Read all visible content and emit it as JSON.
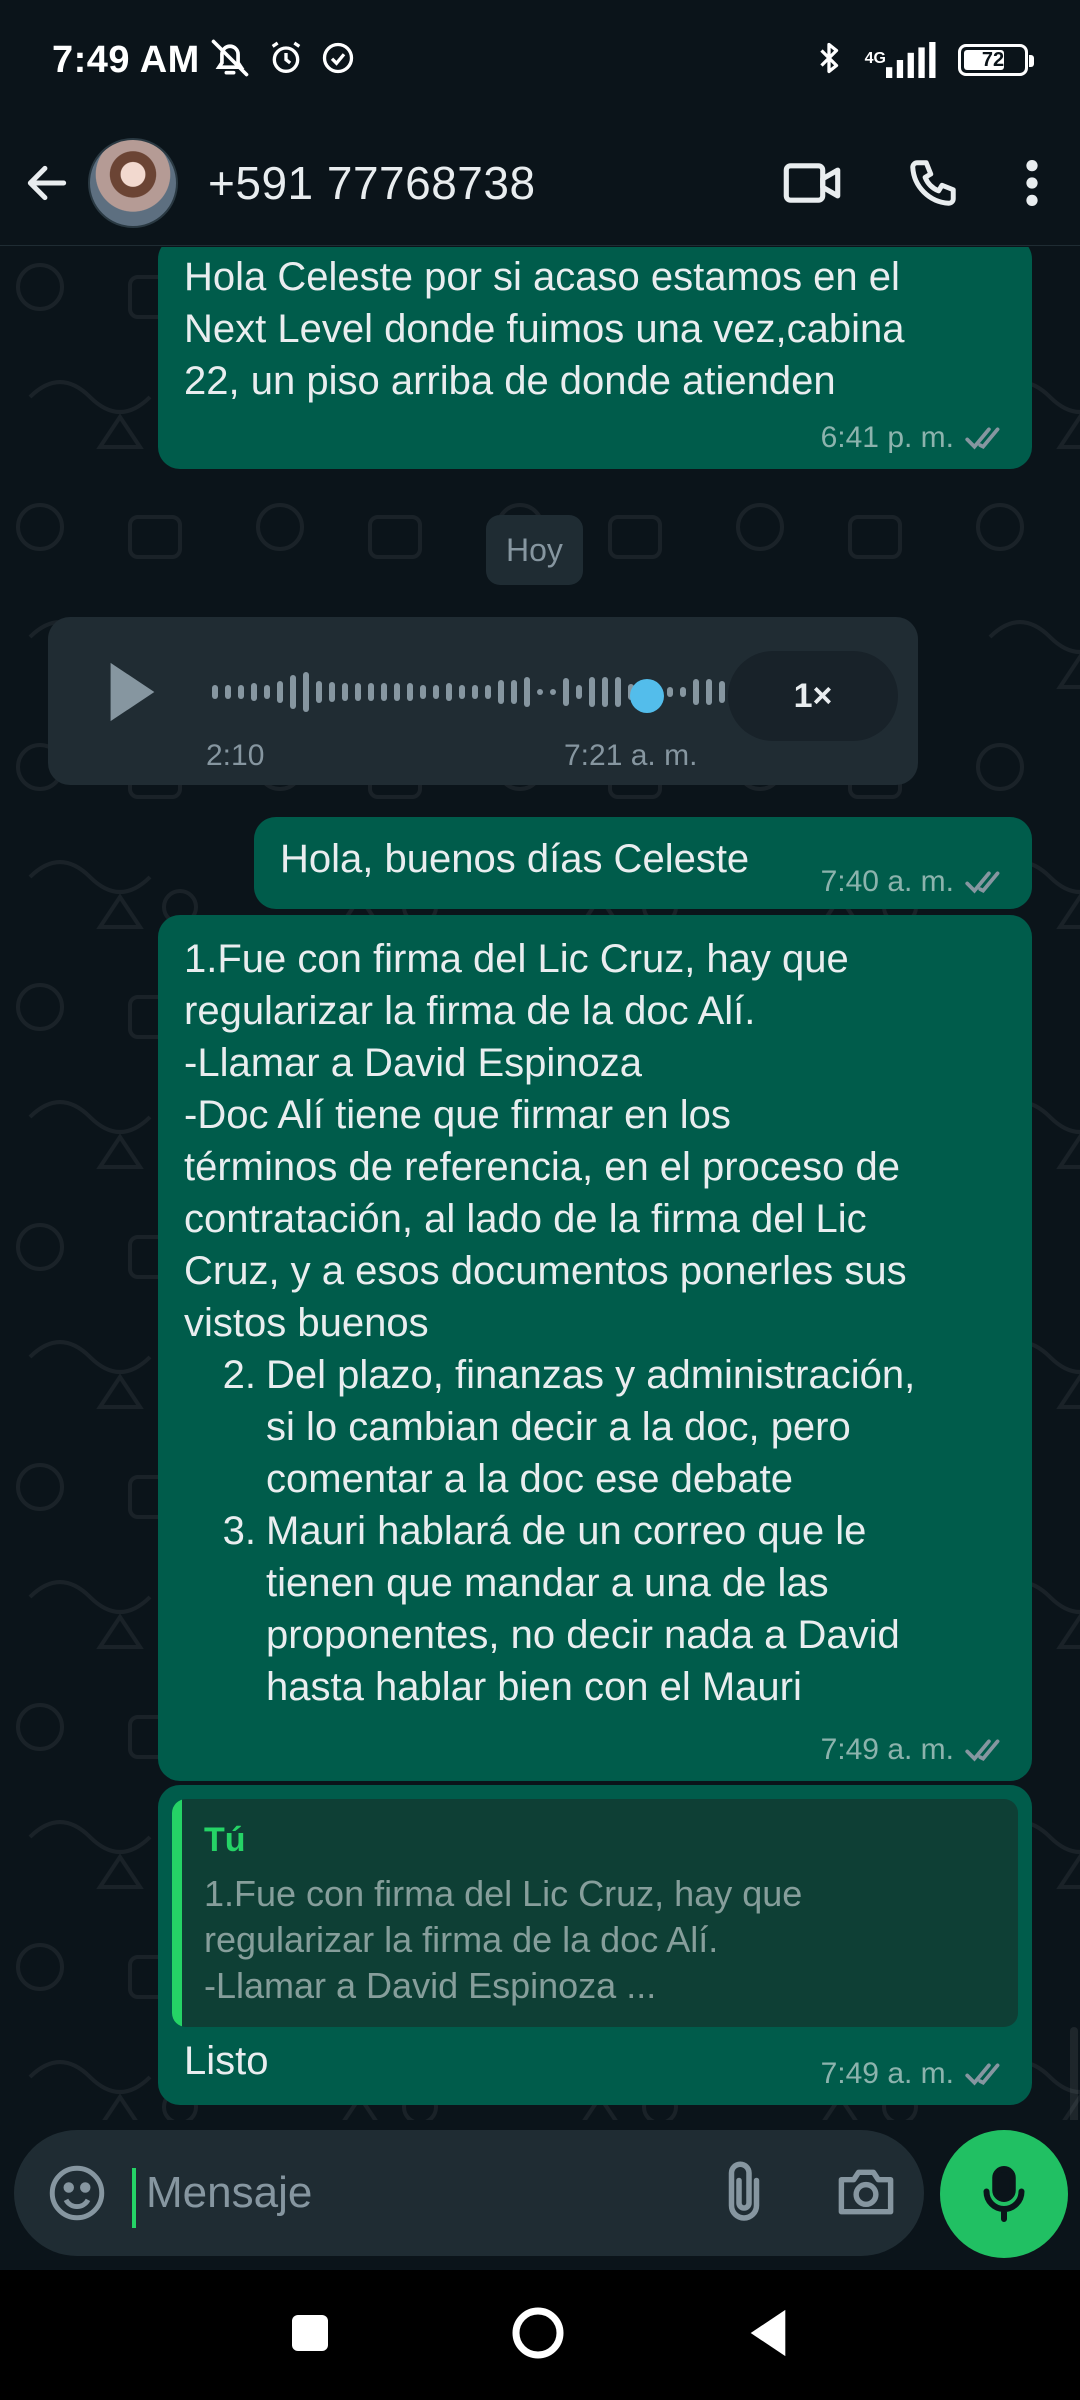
{
  "status_bar": {
    "time": "7:49 AM",
    "network": "4G",
    "battery_level": 72,
    "battery_text": "72",
    "icons": [
      "mute-icon",
      "alarm-icon",
      "check-circle-icon",
      "bluetooth-icon",
      "signal-icon",
      "battery-icon"
    ]
  },
  "header": {
    "contact_name": "+591 77768738",
    "actions": [
      "video-call-icon",
      "voice-call-icon",
      "more-options-icon"
    ]
  },
  "messages": {
    "m1": {
      "text": "Hola Celeste por si acaso estamos en el\nNext Level donde fuimos una vez,cabina\n22, un piso arriba de donde atienden",
      "time": "6:41 p. m."
    },
    "day_chip": "Hoy",
    "audio": {
      "duration": "2:10",
      "time": "7:21 a. m.",
      "speed": "1×",
      "progress": 0.88
    },
    "m2": {
      "text": "Hola, buenos días Celeste",
      "time": "7:40 a. m."
    },
    "m3": {
      "intro": "1.Fue con firma del Lic Cruz, hay que\nregularizar la firma de la doc Alí.\n-Llamar a David Espinoza\n-Doc Alí tiene que firmar en los\ntérminos de referencia, en el proceso de\ncontratación, al lado de la firma del Lic\nCruz, y a esos documentos ponerles sus\nvistos buenos",
      "item2_num": "2.",
      "item2": "Del plazo, finanzas y administración,\nsi lo cambian decir a la doc, pero\ncomentar a la doc ese debate",
      "item3_num": "3.",
      "item3": "Mauri hablará de un correo que le\ntienen que mandar a una de las\nproponentes, no decir nada a David\nhasta hablar bien con el Mauri",
      "time": "7:49 a. m."
    },
    "m4": {
      "quote_author": "Tú",
      "quote_text": "1.Fue con firma del Lic Cruz, hay que\nregularizar la firma de la doc Alí.\n-Llamar a David Espinoza ...",
      "text": "Listo",
      "time": "7:49 a. m."
    }
  },
  "composer": {
    "placeholder": "Mensaje"
  },
  "colors": {
    "background": "#0b141a",
    "outgoing_bubble": "#005c4b",
    "incoming_bubble": "#202c33",
    "accent": "#25d366",
    "read_tick": "#8696a0"
  }
}
